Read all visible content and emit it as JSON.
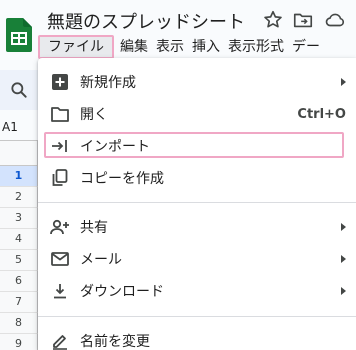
{
  "app": {
    "doc_title": "無題のスプレッドシート",
    "logo_icon": "sheets-logo-icon",
    "brand_color": "#188038"
  },
  "header_icons": [
    "star-icon",
    "move-to-folder-icon",
    "cloud-status-icon"
  ],
  "menubar": {
    "items": [
      {
        "label": "ファイル",
        "active": true
      },
      {
        "label": "編集"
      },
      {
        "label": "表示"
      },
      {
        "label": "挿入"
      },
      {
        "label": "表示形式"
      },
      {
        "label": "デー"
      }
    ]
  },
  "toolbar": {
    "search_icon": "search-icon"
  },
  "sheet": {
    "name_box": "A1",
    "row_numbers": [
      "1",
      "2",
      "3",
      "4",
      "5",
      "6",
      "7",
      "8",
      "9",
      "10"
    ],
    "active_row": "1"
  },
  "file_menu": {
    "highlight_color": "#f0a7c5",
    "items": [
      {
        "label": "新規作成",
        "icon": "new-icon",
        "has_submenu": true
      },
      {
        "label": "開く",
        "icon": "folder-open-icon",
        "shortcut": "Ctrl+O"
      },
      {
        "label": "インポート",
        "icon": "import-icon",
        "highlighted": true
      },
      {
        "label": "コピーを作成",
        "icon": "copy-icon"
      },
      {
        "label": "共有",
        "icon": "share-person-icon",
        "has_submenu": true
      },
      {
        "label": "メール",
        "icon": "mail-icon",
        "has_submenu": true
      },
      {
        "label": "ダウンロード",
        "icon": "download-icon",
        "has_submenu": true
      },
      {
        "label": "名前を変更",
        "icon": "rename-pencil-icon"
      }
    ]
  }
}
